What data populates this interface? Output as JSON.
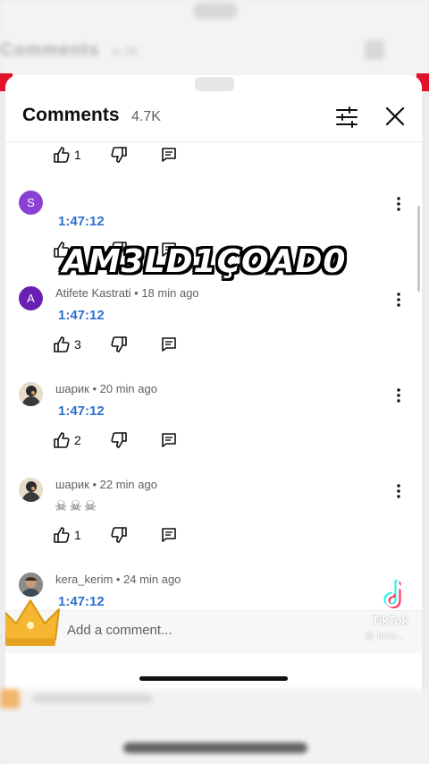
{
  "colors": {
    "accent_timestamp": "#2f6fd0",
    "background_red": "#e1132a",
    "crown": "#f5b731"
  },
  "background": {
    "blur_title": "Comments",
    "blur_count": "4.7K"
  },
  "header": {
    "title": "Comments",
    "count": "4.7K",
    "filter_icon": "sliders-icon",
    "close_icon": "close-icon"
  },
  "overlay_text": "AM3LD1ÇOAD0",
  "comments": [
    {
      "likes": "1"
    },
    {
      "avatar_letter": "S",
      "avatar_color": "#8b40d4",
      "author": "",
      "time": "",
      "text": "1:47:12",
      "likes": ""
    },
    {
      "avatar_letter": "A",
      "avatar_color": "#6a1fb3",
      "author": "Atifete Kastrati",
      "time": "18 min ago",
      "text": "1:47:12",
      "likes": "3"
    },
    {
      "avatar_letter": "",
      "avatar_color": "#c9a77a",
      "author": "шарик",
      "time": "20 min ago",
      "text": "1:47:12",
      "likes": "2"
    },
    {
      "avatar_letter": "",
      "avatar_color": "#c9a77a",
      "author": "шарик",
      "time": "22 min ago",
      "text": "☠☠☠",
      "likes": "1"
    },
    {
      "avatar_letter": "",
      "avatar_color": "#6d6d6d",
      "author": "kera_kerim",
      "time": "24 min ago",
      "text": "1:47:12",
      "likes": ""
    }
  ],
  "add_comment": {
    "placeholder": "Add a comment..."
  },
  "watermark": {
    "brand": "TikTok",
    "handle": "@ kerp..."
  }
}
